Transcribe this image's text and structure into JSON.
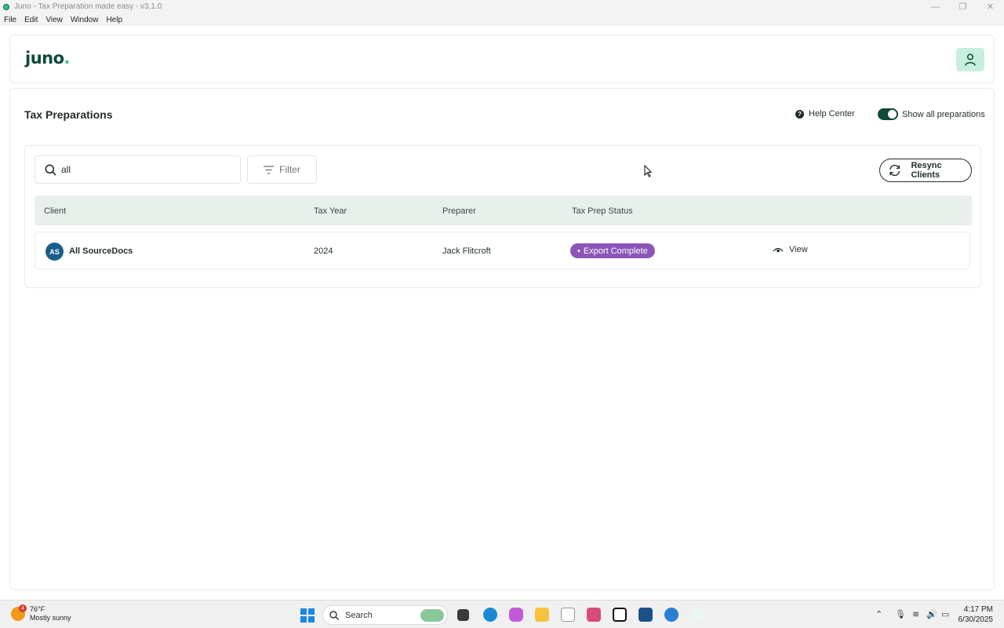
{
  "window": {
    "title": "Juno - Tax Preparation made easy - v3.1.0",
    "controls": [
      "—",
      "❐",
      "✕"
    ]
  },
  "menu": [
    "File",
    "Edit",
    "View",
    "Window",
    "Help"
  ],
  "header": {
    "logo_text": "juno",
    "logo_dot": ".",
    "user_icon": "user-icon"
  },
  "main": {
    "title": "Tax Preparations",
    "help_center": "Help Center",
    "toggle_label": "Show all preparations",
    "toggle_on": true,
    "search": {
      "value": "all",
      "icon": "search-icon"
    },
    "filter_label": "Filter",
    "resync_label": "Resync Clients",
    "table": {
      "columns": [
        "Client",
        "Tax Year",
        "Preparer",
        "Tax Prep Status"
      ],
      "rows": [
        {
          "initials": "AS",
          "client": "All SourceDocs",
          "tax_year": "2024",
          "preparer": "Jack Flitcroft",
          "status": "Export Complete",
          "action": "View"
        }
      ]
    }
  },
  "taskbar": {
    "weather_temp": "76°F",
    "weather_desc": "Mostly sunny",
    "weather_badge": "4",
    "search_label": "Search",
    "time": "4:17 PM",
    "date": "6/30/2025"
  },
  "colors": {
    "brand_dark": "#0f4a3a",
    "brand_accent": "#2fc79a",
    "status_purple": "#8b55b8",
    "avatar_blue": "#1b5e8a"
  }
}
